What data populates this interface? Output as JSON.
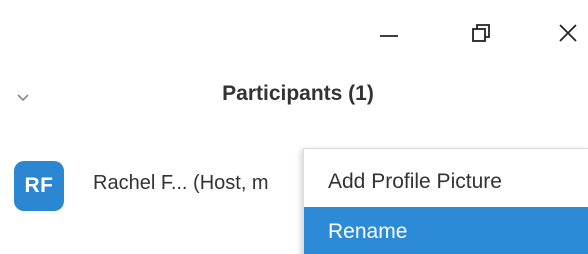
{
  "window_controls": {
    "minimize_icon": "minimize-icon",
    "maximize_icon": "restore-icon",
    "close_icon": "close-icon"
  },
  "panel": {
    "title": "Participants (1)",
    "collapse_icon": "chevron-down-icon"
  },
  "participants": [
    {
      "initials": "RF",
      "name": "Rachel F... (Host, m",
      "avatar_color": "#2b87d1"
    }
  ],
  "context_menu": {
    "items": [
      {
        "label": "Add Profile Picture",
        "highlighted": false
      },
      {
        "label": "Rename",
        "highlighted": true
      }
    ],
    "highlight_color": "#2d8ad6"
  },
  "colors": {
    "text": "#333333",
    "accent": "#2b87d1"
  }
}
